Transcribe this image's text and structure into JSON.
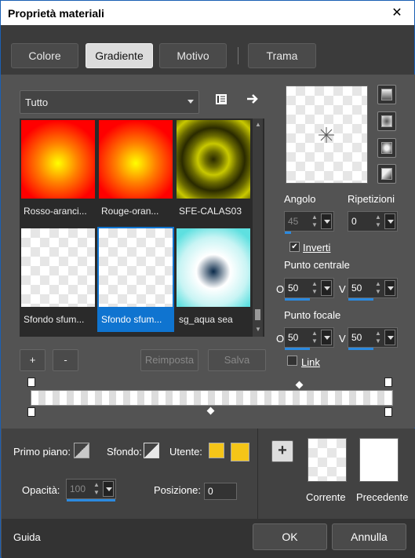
{
  "window": {
    "title": "Proprietà materiali",
    "close_glyph": "✕"
  },
  "tabs": [
    "Colore",
    "Gradiente",
    "Motivo",
    "Trama"
  ],
  "active_tab": "Gradiente",
  "category_dropdown": {
    "value": "Tutto"
  },
  "gradients": [
    {
      "label": "Rosso-aranci..."
    },
    {
      "label": "Rouge-oran..."
    },
    {
      "label": "SFE-CALAS03"
    },
    {
      "label": "Sfondo sfum..."
    },
    {
      "label": "Sfondo sfum..."
    },
    {
      "label": "sg_aqua sea"
    }
  ],
  "list_buttons": {
    "add": "+",
    "remove": "-",
    "reset": "Reimposta",
    "save": "Salva"
  },
  "settings": {
    "angle_label": "Angolo",
    "angle_value": "45",
    "repeats_label": "Ripetizioni",
    "repeats_value": "0",
    "invert_label": "Inverti",
    "invert_checked": true,
    "center_label": "Punto centrale",
    "center_o": "50",
    "center_v": "50",
    "focal_label": "Punto focale",
    "focal_o": "50",
    "focal_v": "50",
    "axis_o": "O",
    "axis_v": "V",
    "link_label": "Link"
  },
  "props": {
    "foreground_label": "Primo piano:",
    "background_label": "Sfondo:",
    "user_label": "Utente:",
    "opacity_label": "Opacità:",
    "opacity_value": "100",
    "position_label": "Posizione:",
    "position_value": "0",
    "add_glyph": "+",
    "current_label": "Corrente",
    "previous_label": "Precedente"
  },
  "footer": {
    "help": "Guida",
    "ok": "OK",
    "cancel": "Annulla"
  },
  "colors": {
    "user_swatch": "#f5c518",
    "selection": "#0f74d0"
  }
}
